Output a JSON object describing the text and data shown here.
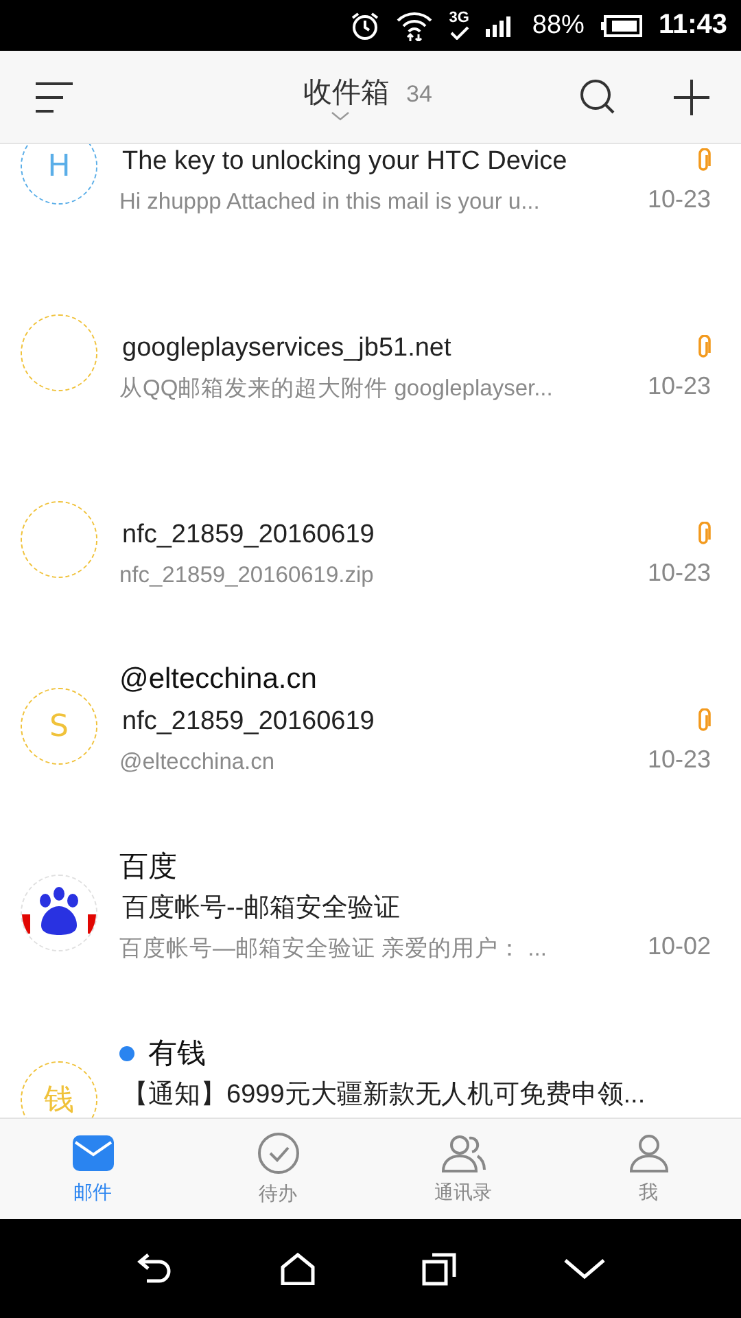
{
  "status_bar": {
    "network": "3G",
    "battery": "88%",
    "time": "11:43"
  },
  "header": {
    "title": "收件箱",
    "count": "34"
  },
  "mails": [
    {
      "avatar": {
        "kind": "letter",
        "letter": "H",
        "color": "#5aaee8"
      },
      "subject": "The key to unlocking your HTC Device",
      "preview": "Hi zhuppp Attached in this mail is your u...",
      "date": "10-23",
      "attachment": true,
      "unread": false
    },
    {
      "avatar": {
        "kind": "letter",
        "color": "#f0c23a"
      },
      "subject": "googleplayservices_jb51.net",
      "preview": "从QQ邮箱发来的超大附件 googleplayser...",
      "date": "10-23",
      "attachment": true,
      "unread": false
    },
    {
      "avatar": {
        "kind": "letter",
        "color": "#f0c23a"
      },
      "subject": "nfc_21859_20160619",
      "preview": "nfc_21859_20160619.zip",
      "date": "10-23",
      "attachment": true,
      "unread": false
    },
    {
      "avatar": {
        "kind": "letter",
        "letter": "S",
        "color": "#f0c23a"
      },
      "sender": "@eltecchina.cn",
      "subject": "nfc_21859_20160619",
      "preview": "@eltecchina.cn",
      "date": "10-23",
      "attachment": true,
      "unread": false
    },
    {
      "avatar": {
        "kind": "logo",
        "color": "#e0e0e0"
      },
      "sender": "百度",
      "subject": "百度帐号--邮箱安全验证",
      "preview": "百度帐号—邮箱安全验证  亲爱的用户：  ...",
      "date": "10-02",
      "attachment": false,
      "unread": false
    },
    {
      "avatar": {
        "kind": "letter",
        "letter": "钱",
        "color": "#f0c23a"
      },
      "sender": "有钱",
      "subject": "【通知】6999元大疆新款无人机可免费申领...",
      "attachment": false,
      "unread": true
    }
  ],
  "tabs": [
    {
      "label": "邮件",
      "selected": true
    },
    {
      "label": "待办",
      "selected": false
    },
    {
      "label": "通讯录",
      "selected": false
    },
    {
      "label": "我",
      "selected": false
    }
  ]
}
